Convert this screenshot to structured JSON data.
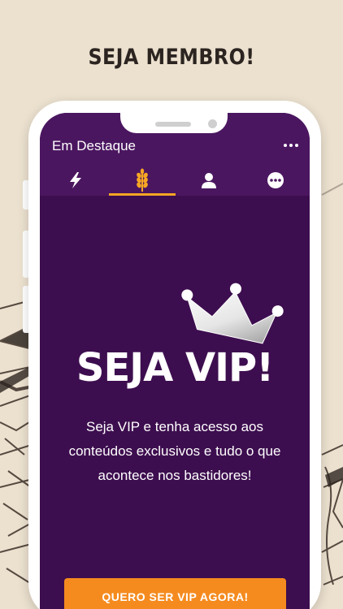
{
  "promo": {
    "headline": "SEJA MEMBRO!"
  },
  "app": {
    "title": "Em Destaque",
    "tabs": [
      {
        "icon": "lightning-icon",
        "active": false
      },
      {
        "icon": "wheat-icon",
        "active": true
      },
      {
        "icon": "user-icon",
        "active": false
      },
      {
        "icon": "more-circle-icon",
        "active": false
      }
    ],
    "accent_color": "#f6a623",
    "background_color": "#3d0e4f"
  },
  "vip": {
    "title": "SEJA VIP!",
    "text": "Seja VIP e tenha acesso aos conteúdos exclusivos e tudo o que acontece nos bastidores!",
    "cta_label": "QUERO SER VIP AGORA!",
    "cta_color": "#f58b1f"
  }
}
